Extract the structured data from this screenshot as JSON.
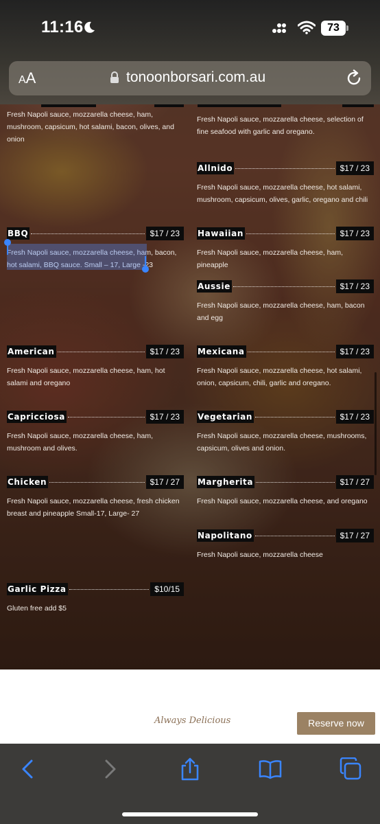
{
  "status_bar": {
    "time": "11:16",
    "battery": "73"
  },
  "browser": {
    "aa_label_small": "A",
    "aa_label_large": "A",
    "url": "tonoonborsari.com.au"
  },
  "menu": {
    "left": [
      {
        "key": "top",
        "name": "",
        "price": "",
        "desc": "Fresh Napoli sauce, mozzarella cheese, ham, mushroom, capsicum, hot salami, bacon, olives, and onion"
      },
      {
        "key": "bbq",
        "name": "BBQ",
        "price": "$17 / 23",
        "desc": "Fresh Napoli sauce, mozzarella cheese, ham, bacon, hot salami, BBQ sauce. Small – 17, Large -23"
      },
      {
        "key": "american",
        "name": "American",
        "price": "$17 / 23",
        "desc": "Fresh Napoli sauce, mozzarella cheese, ham, hot salami and oregano"
      },
      {
        "key": "capricciosa",
        "name": "Capricciosa",
        "price": "$17 / 23",
        "desc": "Fresh Napoli sauce, mozzarella cheese, ham, mushroom and olives."
      },
      {
        "key": "chicken",
        "name": "Chicken",
        "price": "$17 / 27",
        "desc": "Fresh Napoli sauce, mozzarella cheese, fresh chicken breast and pineapple Small-17, Large- 27"
      },
      {
        "key": "garlic",
        "name": "Garlic Pizza",
        "price": "$10/15",
        "desc": "Gluten free add $5"
      }
    ],
    "right": [
      {
        "key": "top",
        "name": "",
        "price": "",
        "desc": "Fresh Napoli sauce, mozzarella cheese, selection of fine seafood with garlic and oregano."
      },
      {
        "key": "allnido",
        "name": "Allnido",
        "price": "$17 / 23",
        "desc": "Fresh Napoli sauce, mozzarella cheese, hot salami, mushroom, capsicum, olives, garlic, oregano and chili"
      },
      {
        "key": "hawaiian",
        "name": "Hawaiian",
        "price": "$17 / 23",
        "desc": "Fresh Napoli sauce, mozzarella cheese, ham, pineapple"
      },
      {
        "key": "aussie",
        "name": "Aussie",
        "price": "$17 / 23",
        "desc": "Fresh Napoli sauce, mozzarella cheese, ham, bacon and egg"
      },
      {
        "key": "mexicana",
        "name": "Mexicana",
        "price": "$17 / 23",
        "desc": "Fresh Napoli sauce, mozzarella cheese, hot salami, onion, capsicum, chili, garlic and oregano."
      },
      {
        "key": "vegetarian",
        "name": "Vegetarian",
        "price": "$17 / 23",
        "desc": "Fresh Napoli sauce, mozzarella cheese, mushrooms, capsicum, olives and onion."
      },
      {
        "key": "margherita",
        "name": "Margherita",
        "price": "$17 / 27",
        "desc": "Fresh Napoli sauce, mozzarella cheese, and oregano"
      },
      {
        "key": "napolitano",
        "name": "Napolitano",
        "price": "$17 / 27",
        "desc": "Fresh Napoli sauce, mozzarella cheese"
      }
    ]
  },
  "footer": {
    "tagline": "Always Delicious",
    "reserve_label": "Reserve now"
  },
  "toolbar": {
    "icons": [
      "back-icon",
      "forward-icon",
      "share-icon",
      "bookmarks-icon",
      "tabs-icon"
    ]
  },
  "colors": {
    "accent_blue": "#3a85ff",
    "reserve_button": "#9b8264",
    "toolbar_bg": "#3c3b39"
  }
}
